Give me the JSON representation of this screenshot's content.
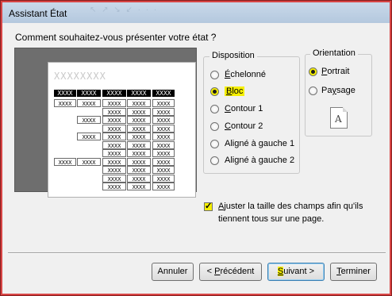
{
  "window": {
    "title": "Assistant État",
    "ghost_text": "↖ ↗ ↘ ↙ · · ·"
  },
  "question": "Comment souhaitez-vous présenter votre état ?",
  "preview": {
    "header_placeholder": "XXXXXXXX",
    "header_cells": [
      "XXXX",
      "XXXX",
      "XXXX",
      "XXXX",
      "XXXX"
    ],
    "cell_text": "XXXX"
  },
  "disposition": {
    "title": "Disposition",
    "options": [
      {
        "label": "Échelonné",
        "selected": false
      },
      {
        "label": "Bloc",
        "selected": true
      },
      {
        "label": "Contour 1",
        "selected": false
      },
      {
        "label": "Contour 2",
        "selected": false
      },
      {
        "label": "Aligné à gauche 1",
        "selected": false
      },
      {
        "label": "Aligné à gauche 2",
        "selected": false
      }
    ]
  },
  "orientation": {
    "title": "Orientation",
    "options": [
      {
        "label": "Portrait",
        "selected": true
      },
      {
        "label": "Paysage",
        "selected": false
      }
    ],
    "icon_letter": "A"
  },
  "adjust_checkbox": {
    "checked": true,
    "line1": "Ajuster la taille des champs afin qu'ils",
    "line2": "tiennent tous sur une page."
  },
  "buttons": {
    "cancel": "Annuler",
    "previous": "< Précédent",
    "next": "Suivant >",
    "finish": "Terminer"
  },
  "colors": {
    "highlight": "#f5ef00",
    "window_border": "#d84545",
    "preview_background": "#6e6e6e"
  }
}
